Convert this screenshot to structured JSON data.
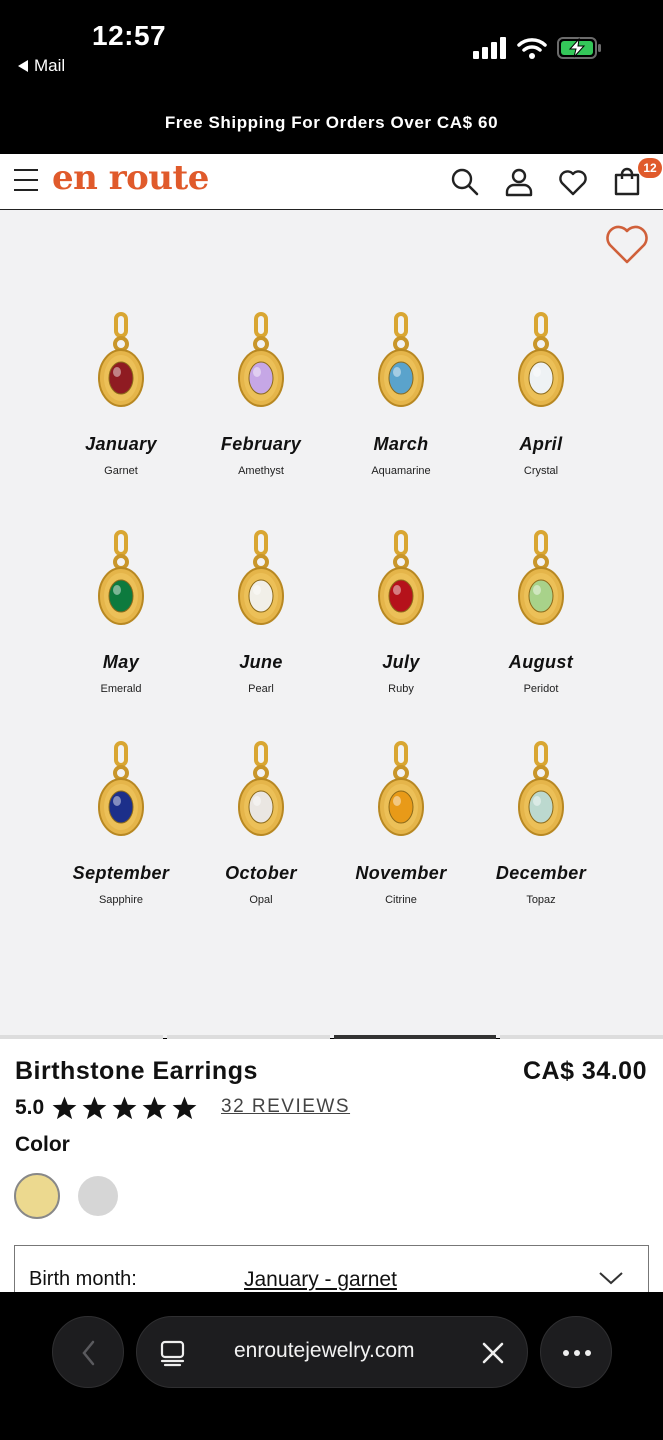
{
  "status": {
    "time": "12:57",
    "back_label": "Mail"
  },
  "promo": {
    "text": "Free Shipping For Orders Over CA$ 60"
  },
  "header": {
    "logo": "en route",
    "cart_count": "12"
  },
  "gallery": {
    "items": [
      {
        "month": "January",
        "stone": "Garnet",
        "color": "#8f1b22"
      },
      {
        "month": "February",
        "stone": "Amethyst",
        "color": "#c6a7e6"
      },
      {
        "month": "March",
        "stone": "Aquamarine",
        "color": "#5aa3cc"
      },
      {
        "month": "April",
        "stone": "Crystal",
        "color": "#eef2f4"
      },
      {
        "month": "May",
        "stone": "Emerald",
        "color": "#0d7a3e"
      },
      {
        "month": "June",
        "stone": "Pearl",
        "color": "#f1efe8"
      },
      {
        "month": "July",
        "stone": "Ruby",
        "color": "#b5121b"
      },
      {
        "month": "August",
        "stone": "Peridot",
        "color": "#a8d28a"
      },
      {
        "month": "September",
        "stone": "Sapphire",
        "color": "#1c2f8a"
      },
      {
        "month": "October",
        "stone": "Opal",
        "color": "#eae6e2"
      },
      {
        "month": "November",
        "stone": "Citrine",
        "color": "#e89a18"
      },
      {
        "month": "December",
        "stone": "Topaz",
        "color": "#bcd9cf"
      }
    ],
    "active_slide": 3,
    "slide_count": 4
  },
  "product": {
    "title": "Birthstone Earrings",
    "price": "CA$ 34.00",
    "rating": "5.0",
    "stars": 5,
    "reviews": "32 REVIEWS",
    "color_label": "Color",
    "colors": [
      "Gold",
      "Silver"
    ],
    "selected_color": "Gold",
    "birth_month_label": "Birth month:",
    "birth_month_value": "January - garnet"
  },
  "browser": {
    "url": "enroutejewelry.com"
  },
  "colors": {
    "brand": "#e05a2b",
    "gold": "#ecd98f",
    "silver": "#d6d6d6"
  }
}
